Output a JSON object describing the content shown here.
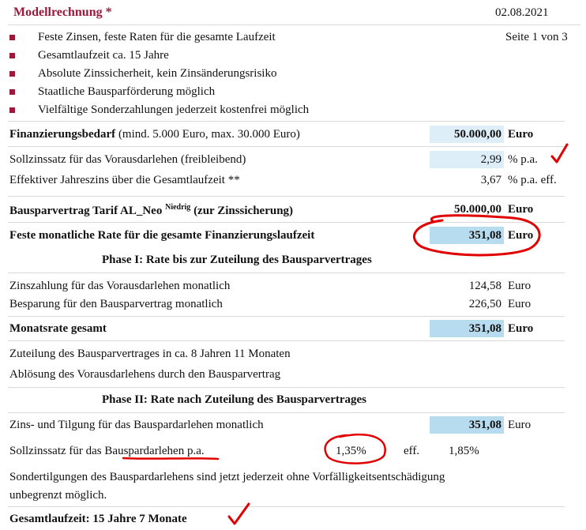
{
  "header": {
    "title": "Modellrechnung *",
    "date": "02.08.2021",
    "page": "Seite 1 von 3"
  },
  "features": [
    "Feste Zinsen, feste Raten für die gesamte Laufzeit",
    "Gesamtlaufzeit ca. 15 Jahre",
    "Absolute Zinssicherheit, kein Zinsänderungsrisiko",
    "Staatliche Bausparförderung möglich",
    "Vielfältige Sonderzahlungen jederzeit kostenfrei möglich"
  ],
  "summary": {
    "bedarf_bold": "Finanzierungsbedarf",
    "bedarf_note": "(mind. 5.000 Euro, max. 30.000 Euro)",
    "bedarf_value": "50.000,00",
    "bedarf_unit": "Euro",
    "sollzins_label": "Sollzinssatz für das Vorausdarlehen (freibleibend)",
    "sollzins_value": "2,99",
    "sollzins_unit": "% p.a.",
    "effektiv_label": "Effektiver Jahreszins über die Gesamtlaufzeit **",
    "effektiv_value": "3,67",
    "effektiv_unit": "% p.a. eff.",
    "bausparvertrag_label": "Bausparvertrag Tarif AL_Neo",
    "bausparvertrag_sup": "Niedrig",
    "bausparvertrag_suffix": "(zur Zinssicherung)",
    "bausparvertrag_value": "50.000,00",
    "bausparvertrag_unit": "Euro",
    "rate_label": "Feste monatliche Rate für die gesamte Finanzierungslaufzeit",
    "rate_value": "351,08",
    "rate_unit": "Euro"
  },
  "phase1": {
    "heading": "Phase I: Rate bis zur Zuteilung des Bausparvertrages",
    "zins_label": "Zinszahlung für das Vorausdarlehen monatlich",
    "zins_value": "124,58",
    "zins_unit": "Euro",
    "besparung_label": "Besparung für den Bausparvertrag monatlich",
    "besparung_value": "226,50",
    "besparung_unit": "Euro",
    "monatsrate_label": "Monatsrate gesamt",
    "monatsrate_value": "351,08",
    "monatsrate_unit": "Euro",
    "zuteilung_text": "Zuteilung des Bausparvertrages in ca. 8 Jahren 11 Monaten",
    "abloesung_text": "Ablösung des Vorausdarlehens durch den Bausparvertrag"
  },
  "phase2": {
    "heading": "Phase II: Rate nach Zuteilung des Bausparvertrages",
    "tilgung_label": "Zins- und Tilgung für das Bauspardarlehen monatlich",
    "tilgung_value": "351,08",
    "tilgung_unit": "Euro",
    "sollzins_prefix": "Sollzinssatz für das",
    "sollzins_word": "Bauspardarlehen",
    "sollzins_suffix": "p.a.",
    "sollzins_value": "1,35%",
    "eff_label": "eff.",
    "eff_value": "1,85%",
    "sondertilgung_line1": "Sondertilgungen des Bauspardarlehens sind jetzt jederzeit ohne Vorfälligkeitsentschädigung",
    "sondertilgung_line2": "unbegrenzt möglich."
  },
  "footer": {
    "laufzeit": "Gesamtlaufzeit: 15 Jahre 7 Monate"
  },
  "colors": {
    "title": "#9b1a3c",
    "highlight_dark": "#b8dcef",
    "highlight_light": "#ddeef8",
    "annotation_red": "#e00000"
  }
}
